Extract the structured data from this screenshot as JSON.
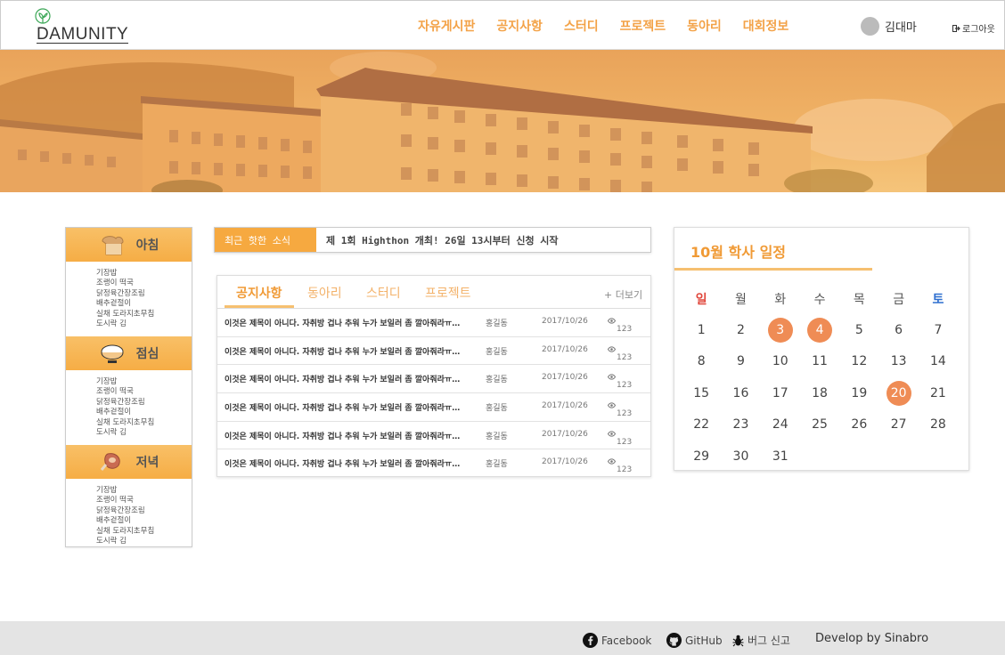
{
  "logo": {
    "text": "DAMUNITY"
  },
  "nav": [
    "자유게시판",
    "공지사항",
    "스터디",
    "프로젝트",
    "동아리",
    "대회정보"
  ],
  "user": {
    "name": "김대마",
    "logout": "로그아웃"
  },
  "meals": [
    {
      "title": "아침",
      "icon": "bread-icon",
      "items": [
        "기장밥",
        "조랭이 떡국",
        "닭정육간장조림",
        "배추겉절이",
        "실채 도라지초무침",
        "도시락 김"
      ]
    },
    {
      "title": "점심",
      "icon": "rice-bowl-icon",
      "items": [
        "기장밥",
        "조랭이 떡국",
        "닭정육간장조림",
        "배추겉절이",
        "실채 도라지초무침",
        "도시락 김"
      ]
    },
    {
      "title": "저녁",
      "icon": "meat-icon",
      "items": [
        "기장밥",
        "조랭이 떡국",
        "닭정육간장조림",
        "배추겉절이",
        "실채 도라지초무침",
        "도시락 김"
      ]
    }
  ],
  "ticker": {
    "label": "최근 핫한 소식",
    "text": "제 1회 Highthon 개최! 26일 13시부터 신청 시작"
  },
  "board": {
    "tabs": [
      "공지사항",
      "동아리",
      "스터디",
      "프로젝트"
    ],
    "more": "+ 더보기",
    "rows": [
      {
        "title": "이것은 제목이 아니다. 자취방 겁나 추워 누가 보일러 좀 깔아줘라ㅠㅠㅠ",
        "author": "홍길동",
        "date": "2017/10/26",
        "views": "123"
      },
      {
        "title": "이것은 제목이 아니다. 자취방 겁나 추워 누가 보일러 좀 깔아줘라ㅠㅠㅠ",
        "author": "홍길동",
        "date": "2017/10/26",
        "views": "123"
      },
      {
        "title": "이것은 제목이 아니다. 자취방 겁나 추워 누가 보일러 좀 깔아줘라ㅠㅠㅠ",
        "author": "홍길동",
        "date": "2017/10/26",
        "views": "123"
      },
      {
        "title": "이것은 제목이 아니다. 자취방 겁나 추워 누가 보일러 좀 깔아줘라ㅠㅠㅠ",
        "author": "홍길동",
        "date": "2017/10/26",
        "views": "123"
      },
      {
        "title": "이것은 제목이 아니다. 자취방 겁나 추워 누가 보일러 좀 깔아줘라ㅠㅠㅠ",
        "author": "홍길동",
        "date": "2017/10/26",
        "views": "123"
      },
      {
        "title": "이것은 제목이 아니다. 자취방 겁나 추워 누가 보일러 좀 깔아줘라ㅠㅠㅠ",
        "author": "홍길동",
        "date": "2017/10/26",
        "views": "123"
      }
    ]
  },
  "calendar": {
    "title": "10월 학사 일정",
    "weekdays": [
      "일",
      "월",
      "화",
      "수",
      "목",
      "금",
      "토"
    ],
    "weeks": [
      [
        "1",
        "2",
        "3",
        "4",
        "5",
        "6",
        "7"
      ],
      [
        "8",
        "9",
        "10",
        "11",
        "12",
        "13",
        "14"
      ],
      [
        "15",
        "16",
        "17",
        "18",
        "19",
        "20",
        "21"
      ],
      [
        "22",
        "23",
        "24",
        "25",
        "26",
        "27",
        "28"
      ],
      [
        "29",
        "30",
        "31",
        "",
        "",
        "",
        ""
      ]
    ],
    "marked": [
      "3",
      "4",
      "20"
    ],
    "mark_color": "#ef8c55"
  },
  "footer": {
    "facebook": "Facebook",
    "github": "GitHub",
    "bug": "버그 신고",
    "dev": "Develop by Sinabro"
  },
  "colors": {
    "accent": "#f3a247",
    "meal_header": "#f6ad45",
    "ticker_label": "#f6a940"
  }
}
